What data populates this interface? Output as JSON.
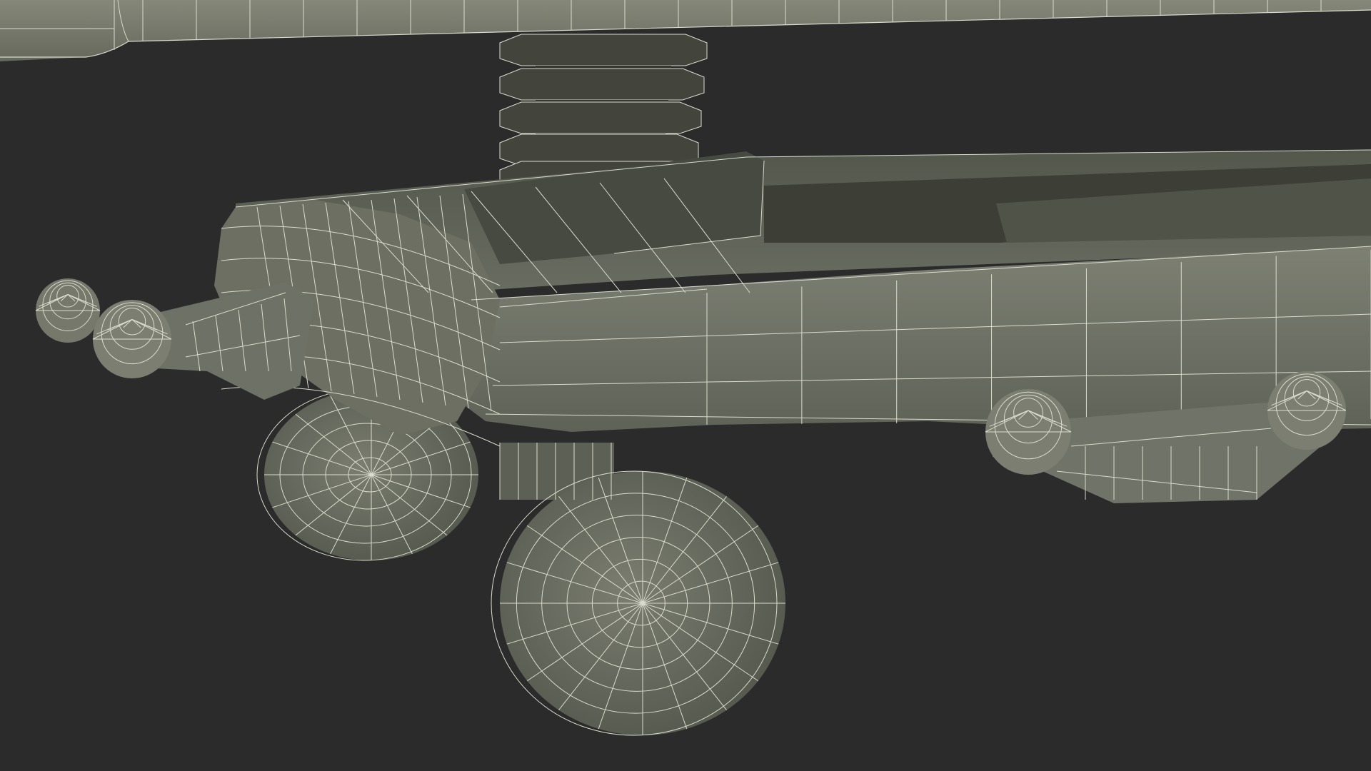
{
  "scene": {
    "subject": "wireframe-render",
    "palette": {
      "background": "#2b2b2b",
      "surface_light": "#777a6d",
      "surface_mid": "#676a5d",
      "surface_dark": "#4a4c43",
      "surface_shadow": "#3b3d36",
      "bellows": "#3f4139",
      "wire": "#d9dccd"
    }
  }
}
